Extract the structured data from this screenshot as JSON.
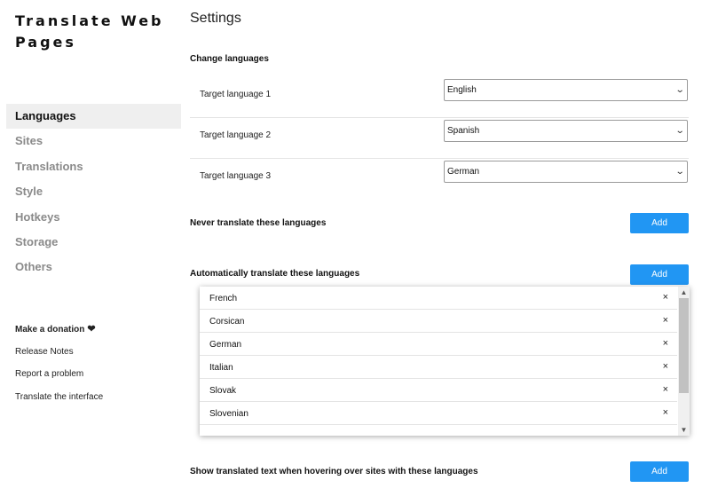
{
  "app_title": "Translate Web Pages",
  "sidebar": {
    "nav": [
      {
        "label": "Languages"
      },
      {
        "label": "Sites"
      },
      {
        "label": "Translations"
      },
      {
        "label": "Style"
      },
      {
        "label": "Hotkeys"
      },
      {
        "label": "Storage"
      },
      {
        "label": "Others"
      }
    ],
    "links": {
      "donate": "Make a donation",
      "release_notes": "Release Notes",
      "report": "Report a problem",
      "translate_interface": "Translate the interface"
    }
  },
  "main": {
    "title": "Settings",
    "change_languages": {
      "label": "Change languages",
      "targets": [
        {
          "label": "Target language 1",
          "value": "English"
        },
        {
          "label": "Target language 2",
          "value": "Spanish"
        },
        {
          "label": "Target language 3",
          "value": "German"
        }
      ]
    },
    "never_translate": {
      "label": "Never translate these languages",
      "button": "Add"
    },
    "auto_translate": {
      "label": "Automatically translate these languages",
      "button": "Add",
      "items": [
        "French",
        "Corsican",
        "German",
        "Italian",
        "Slovak",
        "Slovenian"
      ],
      "remove_glyph": "×"
    },
    "hover_translate": {
      "label": "Show translated text when hovering over sites with these languages",
      "button": "Add"
    }
  }
}
